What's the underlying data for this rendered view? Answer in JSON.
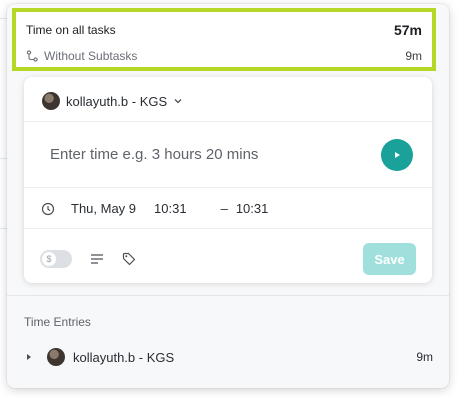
{
  "summary": {
    "title": "Time on all tasks",
    "total": "57m",
    "subtask_label": "Without Subtasks",
    "subtask_value": "9m"
  },
  "entry_form": {
    "user": "kollayuth.b - KGS",
    "time_placeholder": "Enter time e.g. 3 hours 20 mins",
    "date": "Thu, May 9",
    "start_time": "10:31",
    "dash": "–",
    "end_time": "10:31",
    "save_label": "Save"
  },
  "entries": {
    "title": "Time Entries",
    "items": [
      {
        "user": "kollayuth.b - KGS",
        "duration": "9m"
      }
    ]
  },
  "colors": {
    "highlight_border": "#b5d827",
    "accent": "#1aa19a",
    "save_disabled": "#9fe0dc"
  },
  "icons": [
    "subtask-icon",
    "chevron-down-icon",
    "play-icon",
    "clock-icon",
    "billable-icon",
    "notes-icon",
    "tag-icon",
    "caret-right-icon"
  ]
}
